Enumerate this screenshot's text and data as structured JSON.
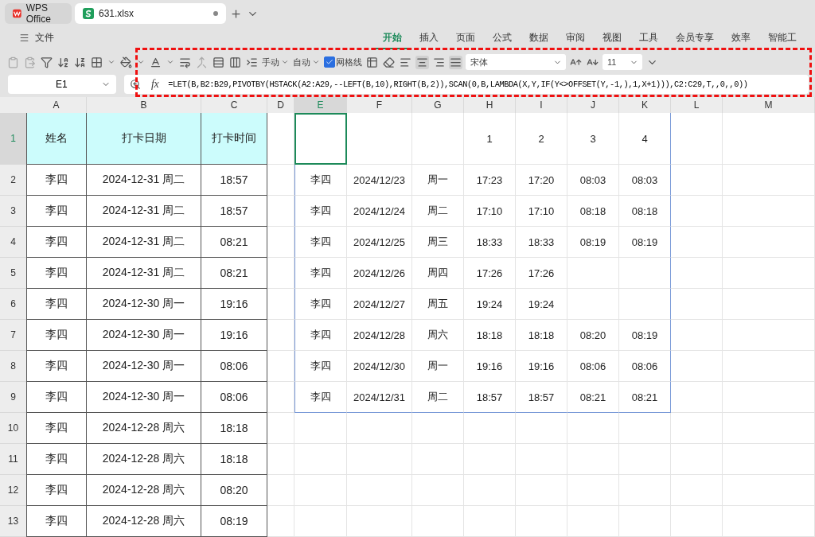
{
  "title_tabs": [
    {
      "kind": "home",
      "label": "WPS Office",
      "selected": false
    },
    {
      "kind": "file",
      "label": "631.xlsx",
      "selected": true,
      "unsaved": true
    }
  ],
  "menu": {
    "file_label": "文件",
    "tabs": [
      {
        "label": "开始",
        "selected": true
      },
      {
        "label": "插入",
        "selected": false
      },
      {
        "label": "页面",
        "selected": false
      },
      {
        "label": "公式",
        "selected": false
      },
      {
        "label": "数据",
        "selected": false
      },
      {
        "label": "审阅",
        "selected": false
      },
      {
        "label": "视图",
        "selected": false
      },
      {
        "label": "工具",
        "selected": false
      },
      {
        "label": "会员专享",
        "selected": false
      },
      {
        "label": "效率",
        "selected": false
      },
      {
        "label": "智能工",
        "selected": false
      }
    ]
  },
  "toolbar": {
    "row_height_mode": "手动",
    "column_width_mode": "自动",
    "gridlines": {
      "label": "网格线",
      "checked": true
    },
    "font": "宋体",
    "font_size": "11"
  },
  "formula_bar": {
    "name_box": "E1",
    "function_label": "fx",
    "formula": "=LET(B,B2:B29,PIVOTBY(HSTACK(A2:A29,--LEFT(B,10),RIGHT(B,2)),SCAN(0,B,LAMBDA(X,Y,IF(Y<>OFFSET(Y,-1,),1,X+1))),C2:C29,T,,0,,0))"
  },
  "sheet": {
    "columns": [
      {
        "label": "A",
        "selected": false
      },
      {
        "label": "B",
        "selected": false
      },
      {
        "label": "C",
        "selected": false
      },
      {
        "label": "D",
        "selected": false
      },
      {
        "label": "E",
        "selected": true
      },
      {
        "label": "F",
        "selected": false
      },
      {
        "label": "G",
        "selected": false
      },
      {
        "label": "H",
        "selected": false
      },
      {
        "label": "I",
        "selected": false
      },
      {
        "label": "J",
        "selected": false
      },
      {
        "label": "K",
        "selected": false
      },
      {
        "label": "L",
        "selected": false
      },
      {
        "label": "M",
        "selected": false
      }
    ],
    "row_numbers": [
      {
        "label": "1",
        "selected": true
      },
      {
        "label": "2",
        "selected": false
      },
      {
        "label": "3",
        "selected": false
      },
      {
        "label": "4",
        "selected": false
      },
      {
        "label": "5",
        "selected": false
      },
      {
        "label": "6",
        "selected": false
      },
      {
        "label": "7",
        "selected": false
      },
      {
        "label": "8",
        "selected": false
      },
      {
        "label": "9",
        "selected": false
      },
      {
        "label": "10",
        "selected": false
      },
      {
        "label": "11",
        "selected": false
      },
      {
        "label": "12",
        "selected": false
      },
      {
        "label": "13",
        "selected": false
      }
    ],
    "source_table": {
      "headers": [
        "姓名",
        "打卡日期",
        "打卡时间"
      ],
      "rows": [
        [
          "李四",
          "2024-12-31 周二",
          "18:57"
        ],
        [
          "李四",
          "2024-12-31 周二",
          "18:57"
        ],
        [
          "李四",
          "2024-12-31 周二",
          "08:21"
        ],
        [
          "李四",
          "2024-12-31 周二",
          "08:21"
        ],
        [
          "李四",
          "2024-12-30 周一",
          "19:16"
        ],
        [
          "李四",
          "2024-12-30 周一",
          "19:16"
        ],
        [
          "李四",
          "2024-12-30 周一",
          "08:06"
        ],
        [
          "李四",
          "2024-12-30 周一",
          "08:06"
        ],
        [
          "李四",
          "2024-12-28 周六",
          "18:18"
        ],
        [
          "李四",
          "2024-12-28 周六",
          "18:18"
        ],
        [
          "李四",
          "2024-12-28 周六",
          "08:20"
        ],
        [
          "李四",
          "2024-12-28 周六",
          "08:19"
        ]
      ]
    },
    "pivot_table": {
      "headers": [
        "1",
        "2",
        "3",
        "4"
      ],
      "rows": [
        [
          "李四",
          "2024/12/23",
          "周一",
          "17:23",
          "17:20",
          "08:03",
          "08:03"
        ],
        [
          "李四",
          "2024/12/24",
          "周二",
          "17:10",
          "17:10",
          "08:18",
          "08:18"
        ],
        [
          "李四",
          "2024/12/25",
          "周三",
          "18:33",
          "18:33",
          "08:19",
          "08:19"
        ],
        [
          "李四",
          "2024/12/26",
          "周四",
          "17:26",
          "17:26"
        ],
        [
          "李四",
          "2024/12/27",
          "周五",
          "19:24",
          "19:24"
        ],
        [
          "李四",
          "2024/12/28",
          "周六",
          "18:18",
          "18:18",
          "08:20",
          "08:19"
        ],
        [
          "李四",
          "2024/12/30",
          "周一",
          "19:16",
          "19:16",
          "08:06",
          "08:06"
        ],
        [
          "李四",
          "2024/12/31",
          "周二",
          "18:57",
          "18:57",
          "08:21",
          "08:21"
        ]
      ]
    }
  },
  "annotation": {
    "kind": "dashed-frame"
  }
}
